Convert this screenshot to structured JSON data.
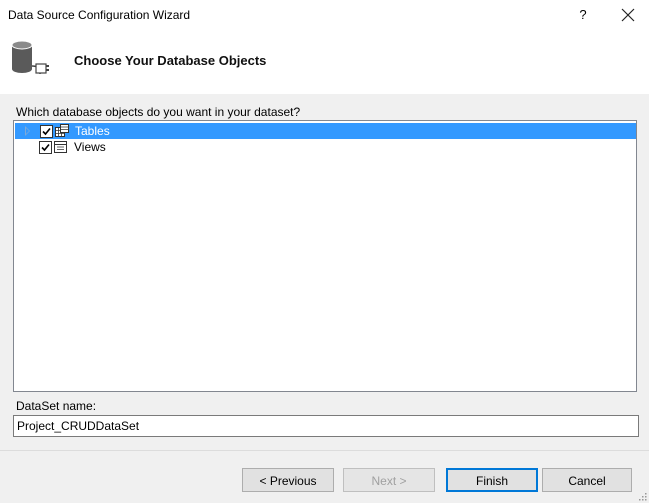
{
  "window": {
    "title": "Data Source Configuration Wizard",
    "help_label": "?",
    "close_label": "✕"
  },
  "header": {
    "title": "Choose Your Database Objects",
    "icon": "database-connect-icon"
  },
  "prompt": "Which database objects do you want in your dataset?",
  "tree": {
    "items": [
      {
        "label": "Tables",
        "checked": true,
        "expandable": true,
        "selected": true,
        "icon": "table-icon"
      },
      {
        "label": "Views",
        "checked": true,
        "expandable": false,
        "selected": false,
        "icon": "view-icon"
      }
    ]
  },
  "dataset": {
    "label": "DataSet name:",
    "value": "Project_CRUDDataSet"
  },
  "buttons": {
    "previous": "< Previous",
    "next": "Next >",
    "finish": "Finish",
    "cancel": "Cancel"
  },
  "colors": {
    "selection": "#3399ff",
    "focus": "#0078d7"
  }
}
